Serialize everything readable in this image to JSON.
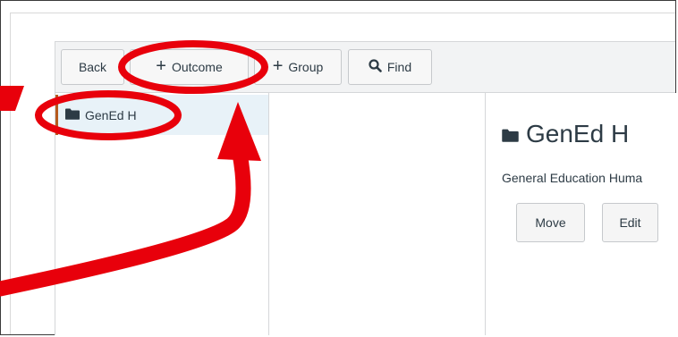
{
  "toolbar": {
    "back_label": "Back",
    "outcome_label": "Outcome",
    "group_label": "Group",
    "find_label": "Find"
  },
  "tree": {
    "selected_item_label": "GenEd H"
  },
  "detail": {
    "title": "GenEd H",
    "description": "General Education Huma",
    "move_label": "Move",
    "edit_label": "Edit"
  },
  "annotations": {
    "color": "#e8000b"
  }
}
